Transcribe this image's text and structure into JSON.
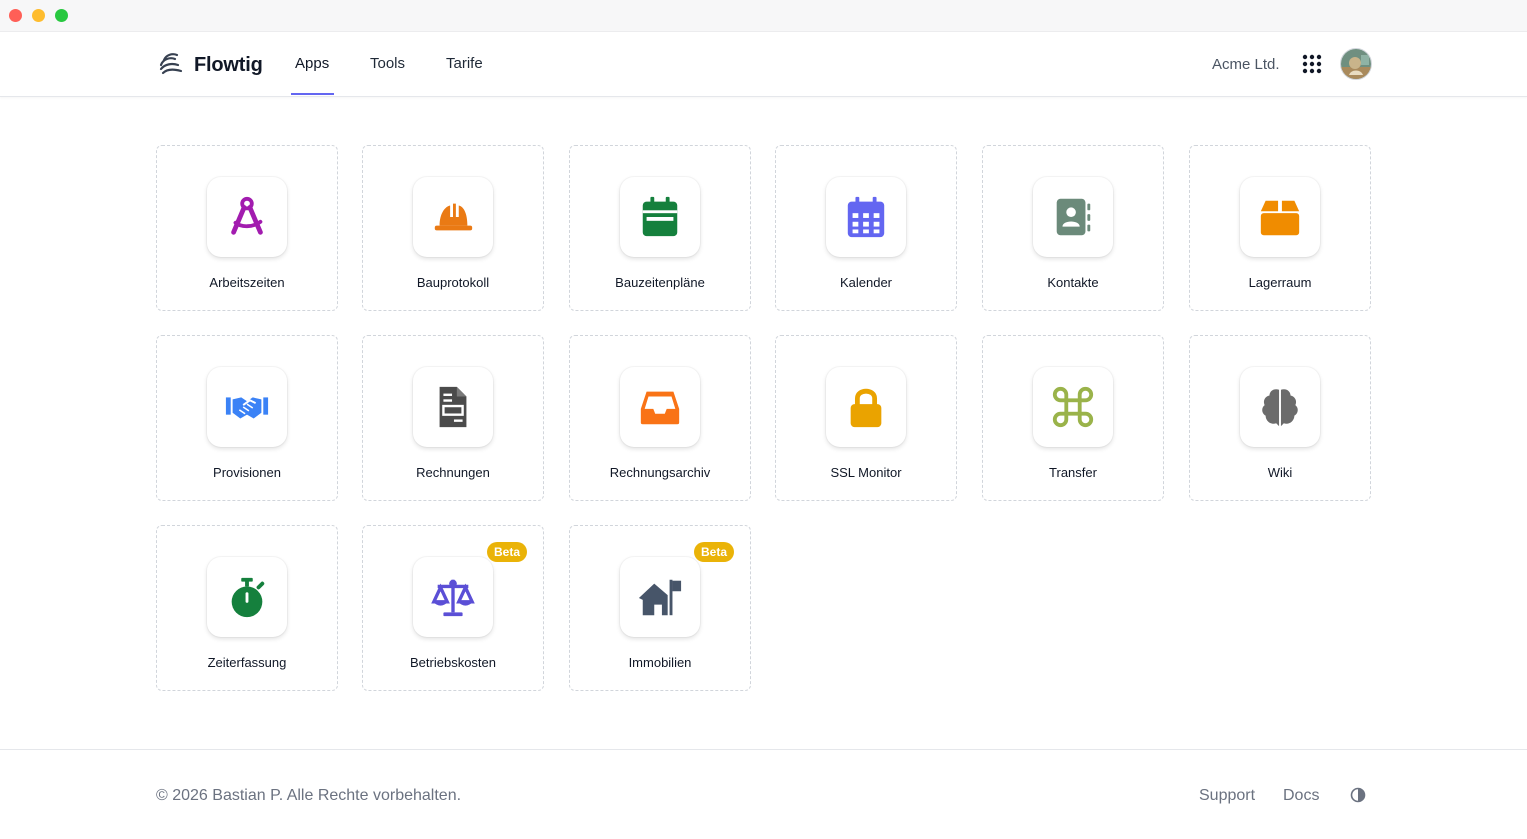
{
  "window": {
    "controls": [
      "close",
      "minimize",
      "maximize"
    ]
  },
  "header": {
    "brand": "Flowtig",
    "nav": {
      "apps": "Apps",
      "tools": "Tools",
      "tarife": "Tarife"
    },
    "active_nav": "Apps",
    "organization": "Acme Ltd.",
    "accent_color": "#6366f1"
  },
  "apps": [
    {
      "label": "Arbeitszeiten",
      "icon": "drafting-compass-icon",
      "color": "#a21caf"
    },
    {
      "label": "Bauprotokoll",
      "icon": "hard-hat-icon",
      "color": "#ea7a14"
    },
    {
      "label": "Bauzeitenpläne",
      "icon": "calendar-icon",
      "color": "#15803d"
    },
    {
      "label": "Kalender",
      "icon": "calendar-days-icon",
      "color": "#6366f1"
    },
    {
      "label": "Kontakte",
      "icon": "address-book-icon",
      "color": "#6b8a7a"
    },
    {
      "label": "Lagerraum",
      "icon": "box-icon",
      "color": "#f08c00"
    },
    {
      "label": "Provisionen",
      "icon": "handshake-icon",
      "color": "#3b82f6"
    },
    {
      "label": "Rechnungen",
      "icon": "file-invoice-icon",
      "color": "#4b4b4b"
    },
    {
      "label": "Rechnungsarchiv",
      "icon": "inbox-icon",
      "color": "#f97316"
    },
    {
      "label": "SSL Monitor",
      "icon": "lock-icon",
      "color": "#eaa300"
    },
    {
      "label": "Transfer",
      "icon": "command-icon",
      "color": "#9ab34a"
    },
    {
      "label": "Wiki",
      "icon": "brain-icon",
      "color": "#6b6b6b"
    },
    {
      "label": "Zeiterfassung",
      "icon": "stopwatch-icon",
      "color": "#15803d"
    },
    {
      "label": "Betriebskosten",
      "icon": "scale-balanced-icon",
      "color": "#5b4fd6",
      "badge": "Beta"
    },
    {
      "label": "Immobilien",
      "icon": "house-flag-icon",
      "color": "#475569",
      "badge": "Beta"
    }
  ],
  "badge_color": "#eab308",
  "footer": {
    "copyright": "© 2026 Bastian P. Alle Rechte vorbehalten.",
    "support": "Support",
    "docs": "Docs"
  }
}
